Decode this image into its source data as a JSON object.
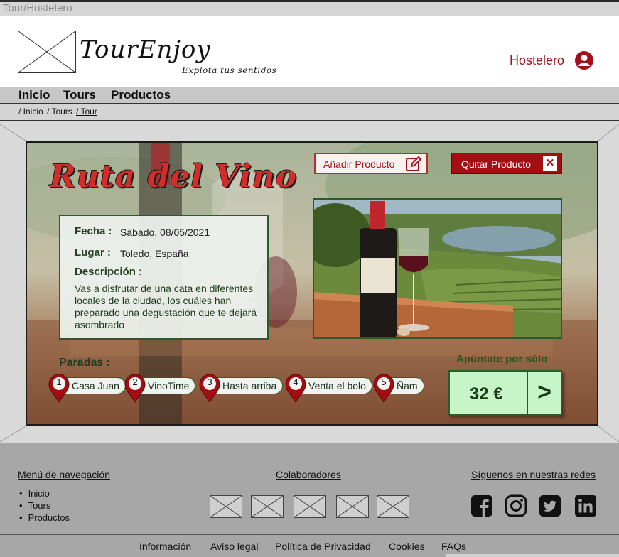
{
  "window": {
    "title": "Tour/Hostelero"
  },
  "header": {
    "logo_title": "TourEnjoy",
    "logo_subtitle": "Explota tus sentidos",
    "user_label": "Hostelero",
    "user_icon": "user-circle-icon"
  },
  "nav": {
    "items": [
      "Inicio",
      "Tours",
      "Productos"
    ]
  },
  "breadcrumb": {
    "items": [
      "/ Inicio",
      "/ Tours",
      "/ Tour"
    ]
  },
  "tour": {
    "title": "Ruta del Vino",
    "add_button": "Añadir Producto",
    "remove_button": "Quitar Producto",
    "fecha_label": "Fecha :",
    "fecha_value": "Sábado, 08/05/2021",
    "lugar_label": "Lugar :",
    "lugar_value": "Toledo, España",
    "descripcion_label": "Descripción :",
    "descripcion_value": "Vas a disfrutar de una cata en diferentes locales de la ciudad, los cuáles han preparado una degustación que te dejará asombrado",
    "paradas_label": "Paradas :",
    "stops": [
      {
        "num": "1",
        "name": "Casa Juan"
      },
      {
        "num": "2",
        "name": "VinoTime"
      },
      {
        "num": "3",
        "name": "Hasta arriba"
      },
      {
        "num": "4",
        "name": "Venta el bolo"
      },
      {
        "num": "5",
        "name": "Ñam"
      }
    ],
    "cta_label": "Apúntate por sólo",
    "price": "32 €",
    "go_symbol": ">"
  },
  "footer": {
    "nav_heading": "Menú de navegación",
    "nav_items": [
      "Inicio",
      "Tours",
      "Productos"
    ],
    "collab_heading": "Colaboradores",
    "social_heading": "Síguenos en nuestras redes",
    "social_icons": [
      "facebook-icon",
      "instagram-icon",
      "twitter-icon",
      "linkedin-icon"
    ],
    "links": [
      "Información",
      "Aviso legal",
      "Política de Privacidad",
      "Cookies",
      "FAQs"
    ]
  },
  "colors": {
    "brand_red": "#a3101a",
    "accent_green": "#2c5a2a",
    "price_bg": "#c8f5c8"
  }
}
